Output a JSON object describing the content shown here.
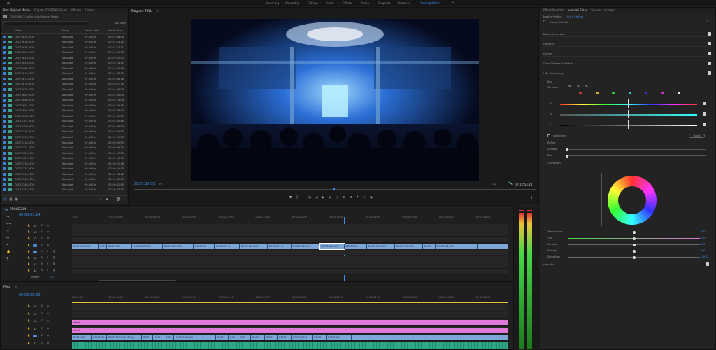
{
  "workspaces": {
    "items": [
      "Learning",
      "Assembly",
      "Editing",
      "Color",
      "Effects",
      "Audio",
      "Graphics",
      "Libraries",
      "RemingNOOK"
    ],
    "active_index": 8
  },
  "project_panel": {
    "tabs": [
      "Bin: Original Media",
      "Project: TRIGENIA 2L.loi",
      "Effects",
      "History"
    ],
    "path": "TRIGENIA 2L.lei/prjucts/Original Media",
    "item_count": "144 Items",
    "columns": [
      "Name",
      "Proxy",
      "Frame Rate",
      "Media Start"
    ],
    "rows": [
      {
        "name": "DSCF5622.MOV",
        "proxy": "Attached",
        "fps": "59.94 fps",
        "start": "00:23:48:06"
      },
      {
        "name": "DSCF5630.MOV",
        "proxy": "Attached",
        "fps": "59.94 fps",
        "start": "00:23:53:26"
      },
      {
        "name": "DSCF5636.MOV",
        "proxy": "Attached",
        "fps": "59.94 fps",
        "start": "00:23:57:11"
      },
      {
        "name": "DSCF5649.MOV",
        "proxy": "Attached",
        "fps": "59.94 fps",
        "start": "00:24:00:08"
      },
      {
        "name": "DSCF5653.MOV",
        "proxy": "Attached",
        "fps": "59.94 fps",
        "start": "00:24:03:00"
      },
      {
        "name": "DSCF5659.MOV",
        "proxy": "Attached",
        "fps": "59.94 fps",
        "start": "00:24:18:55"
      },
      {
        "name": "DSCF5666.MOV",
        "proxy": "Attached",
        "fps": "59.94 fps",
        "start": "00:24:25:48"
      },
      {
        "name": "DSCF5670.MOV",
        "proxy": "Attached",
        "fps": "59.94 fps",
        "start": "00:24:33:05"
      },
      {
        "name": "DSCF5673.MOV",
        "proxy": "Attached",
        "fps": "59.94 fps",
        "start": "00:24:36:16"
      },
      {
        "name": "DSCF5676.MOV",
        "proxy": "Attached",
        "fps": "59.94 fps",
        "start": "00:24:47:36"
      },
      {
        "name": "DSCF5679.MOV",
        "proxy": "Attached",
        "fps": "59.94 fps",
        "start": "00:24:49:06"
      },
      {
        "name": "DSCF5682.MOV",
        "proxy": "Attached",
        "fps": "59.94 fps",
        "start": "00:25:04:06"
      },
      {
        "name": "DSCF5688.MOV",
        "proxy": "Attached",
        "fps": "59.94 fps",
        "start": "00:25:14:06"
      },
      {
        "name": "DSCF5691.MOV",
        "proxy": "Attached",
        "fps": "59.94 fps",
        "start": "00:25:20:16"
      },
      {
        "name": "DSCF5694.MOV",
        "proxy": "Attached",
        "fps": "59.94 fps",
        "start": "00:25:28:06"
      },
      {
        "name": "DSCF5698.MOV",
        "proxy": "Attached",
        "fps": "59.94 fps",
        "start": "00:25:31:30"
      },
      {
        "name": "DSCF5701.MOV",
        "proxy": "Attached",
        "fps": "59.94 fps",
        "start": "00:25:35:48"
      },
      {
        "name": "DSCF5706.MOV",
        "proxy": "Attached",
        "fps": "59.94 fps",
        "start": "00:25:38:06"
      },
      {
        "name": "DSCF5710.MOV",
        "proxy": "Attached",
        "fps": "59.94 fps",
        "start": "00:25:44:08"
      },
      {
        "name": "DSCF5714.MOV",
        "proxy": "Attached",
        "fps": "59.94 fps",
        "start": "00:26:01:05"
      },
      {
        "name": "DSCF5718.MOV",
        "proxy": "Attached",
        "fps": "59.94 fps",
        "start": "00:26:05:50"
      },
      {
        "name": "DSCF5721.MOV",
        "proxy": "Attached",
        "fps": "59.94 fps",
        "start": "00:26:09:20"
      },
      {
        "name": "DSCF5725.MOV",
        "proxy": "Attached",
        "fps": "59.94 fps",
        "start": "00:26:12:06"
      },
      {
        "name": "DSCF5729.MOV",
        "proxy": "Attached",
        "fps": "59.94 fps",
        "start": "00:26:16:35"
      },
      {
        "name": "DSCF5733.MOV",
        "proxy": "Attached",
        "fps": "59.94 fps",
        "start": "00:26:21:18"
      },
      {
        "name": "DSCF5737.MOV",
        "proxy": "Attached",
        "fps": "59.94 fps",
        "start": "00:26:24:06"
      },
      {
        "name": "DSCF5740.MOV",
        "proxy": "Attached",
        "fps": "59.94 fps",
        "start": "00:26:28:48"
      },
      {
        "name": "DSCF5744.MOV",
        "proxy": "Attached",
        "fps": "59.94 fps",
        "start": "00:26:33:06"
      },
      {
        "name": "DSCF5748.MOV",
        "proxy": "Attached",
        "fps": "59.94 fps",
        "start": "00:26:41:40"
      },
      {
        "name": "DSCF5752.MOV",
        "proxy": "Attached",
        "fps": "59.94 fps",
        "start": "00:26:47:06"
      }
    ]
  },
  "program_monitor": {
    "tab": "Program: FULL",
    "timecode": "00:00:38:00",
    "fit": "Fit",
    "quality": "1/2",
    "duration": "00:02:53:22"
  },
  "timeline_top": {
    "tab": "PROCESSIN",
    "timecode": "00:03:03:14",
    "ruler": [
      "3:00",
      "00:02:00:00",
      "00:02:05:00",
      "00:02:10:00",
      "00:02:15:00",
      "00:02:20:00",
      "00:02:25:00",
      "00:02:30:00",
      "00:02:35:00",
      "00:02:40:00",
      "00:02:45:00",
      "00:02:50:00"
    ],
    "tracks": [
      "V4",
      "V3",
      "V2",
      "V1",
      "A1",
      "A2",
      "A3",
      "A4"
    ],
    "master": "Master",
    "master_val": "0.0",
    "clips": [
      "DSCF5625.MOV",
      "DSC",
      "DSCF5634",
      "DSCF5640.MOV",
      "DSCF5649.MOV",
      "DSCF5651",
      "DSCF5657.M",
      "DSCF5663.MOV",
      "DSCF5671.M",
      "DSCF5676.MOV",
      "DSCF5684.MOV",
      "DSCF5690",
      "DSCF5697.MOV",
      "DSCF5704.MOV",
      "DSCF5",
      "DSCF5711.MOV"
    ]
  },
  "timeline_bottom": {
    "tab": "FULL",
    "timecode": "00:00:38:00",
    "ruler": [
      "00:00:00",
      "00:00:05:00",
      "00:00:10:00",
      "00:00:15:00",
      "00:00:20:00",
      "00:00:25:00",
      "00:00:30:00",
      "00:00:35:00",
      "00:00:40:00",
      "00:00:45:00",
      "00:00:50:00",
      "00:00:55:00"
    ],
    "tracks": [
      "V5",
      "V4",
      "V3",
      "V2",
      "V1",
      "A1"
    ],
    "fx_labels": [
      "effect",
      "effect"
    ],
    "clips": [
      "DSCF5685",
      "DSCF6049.M",
      "DSCF5524.MOV [80%]",
      "DSCF",
      "DSCF",
      "DSC",
      "DSCF5592.MOV",
      "DSCF5",
      "DSC",
      "DSCF",
      "DSCF5",
      "DSCF",
      "DSCF5",
      "DSCF5683.M",
      "DSCF5",
      "DSCF5684"
    ]
  },
  "effect_controls": {
    "tabs": [
      "Effect Controls",
      "Lumetri Color",
      "Source: (no clips)"
    ],
    "master": "Master * effect",
    "clip": "FULL * effect",
    "effect_name": "Lumetri Color",
    "sections": [
      "Basic Correction",
      "Creative",
      "Curves",
      "Color Wheels & Match",
      "HSL Secondary"
    ],
    "key_label": "Key",
    "set_color": "Set color",
    "hsl_letters": [
      "H",
      "S",
      "L"
    ],
    "color_gray": "Color/Gray",
    "reset": "Reset",
    "refine": "Refine",
    "denoise": "Denoise",
    "blur": "Blur",
    "correction": "Correction",
    "sliders": [
      {
        "label": "Temperature",
        "value": "0.0",
        "pos": 0.5
      },
      {
        "label": "Tint",
        "value": "0.0",
        "pos": 0.5
      },
      {
        "label": "Contrast",
        "value": "0.0",
        "pos": 0.5
      },
      {
        "label": "Sharpen",
        "value": "0.0",
        "pos": 0.5
      },
      {
        "label": "Saturation",
        "value": "100.0",
        "pos": 0.5
      }
    ],
    "vignette": "Vignette",
    "swatches": [
      "#d83232",
      "#d8b832",
      "#32c832",
      "#32c8c8",
      "#3232d8",
      "#c832c8",
      "#e8e8e8"
    ]
  },
  "colors": {
    "accent": "#3d8ee8",
    "clip_blue": "#7ea6d8",
    "clip_pink": "#e07ad8",
    "clip_green": "#2fa88a",
    "clip_yellow": "#e8c43a"
  }
}
